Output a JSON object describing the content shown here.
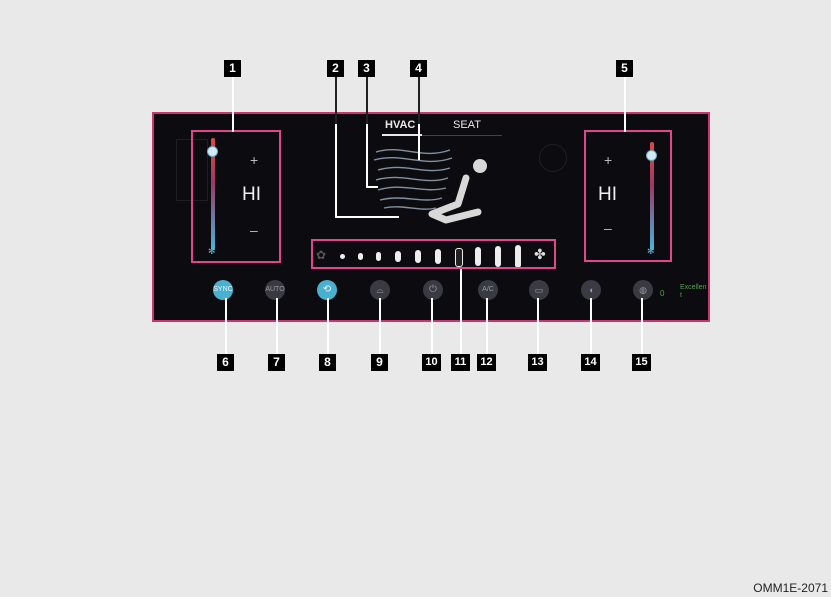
{
  "tabs": [
    {
      "label": "HVAC",
      "active": true
    },
    {
      "label": "SEAT",
      "active": false
    }
  ],
  "left_zone": {
    "temp_label": "HI",
    "plus": "+",
    "minus": "–"
  },
  "right_zone": {
    "temp_label": "HI",
    "plus": "+",
    "minus": "–"
  },
  "buttons": [
    {
      "name": "sync-button",
      "label": "SYNC",
      "active": true
    },
    {
      "name": "auto-button",
      "label": "AUTO",
      "active": false
    },
    {
      "name": "recirculation-button",
      "label": "recirculation-icon",
      "active": true
    },
    {
      "name": "front-defroster-button",
      "label": "front-defroster-icon",
      "active": false
    },
    {
      "name": "power-button",
      "label": "power-icon",
      "active": false
    },
    {
      "name": "ac-button",
      "label": "A/C",
      "active": false
    },
    {
      "name": "rear-defroster-button",
      "label": "rear-defroster-icon",
      "active": false
    },
    {
      "name": "climate-concierge-button",
      "label": "climate-concierge-icon",
      "active": false
    },
    {
      "name": "air-purifier-button",
      "label": "air-purifier-icon",
      "active": false
    }
  ],
  "air_quality": {
    "value": "0",
    "text": "Excellent"
  },
  "fan_speed": {
    "levels": 11,
    "icon": "fan-icon"
  },
  "callouts": [
    "1",
    "2",
    "3",
    "4",
    "5",
    "6",
    "7",
    "8",
    "9",
    "10",
    "11",
    "12",
    "13",
    "14",
    "15"
  ],
  "footer": {
    "code": "OMM1E-2071"
  },
  "colors": {
    "highlight": "#e0478a",
    "panel": "#0c0c10",
    "active_button": "#4ab0d0",
    "hot": "#e04848",
    "cold": "#48b4d8"
  }
}
